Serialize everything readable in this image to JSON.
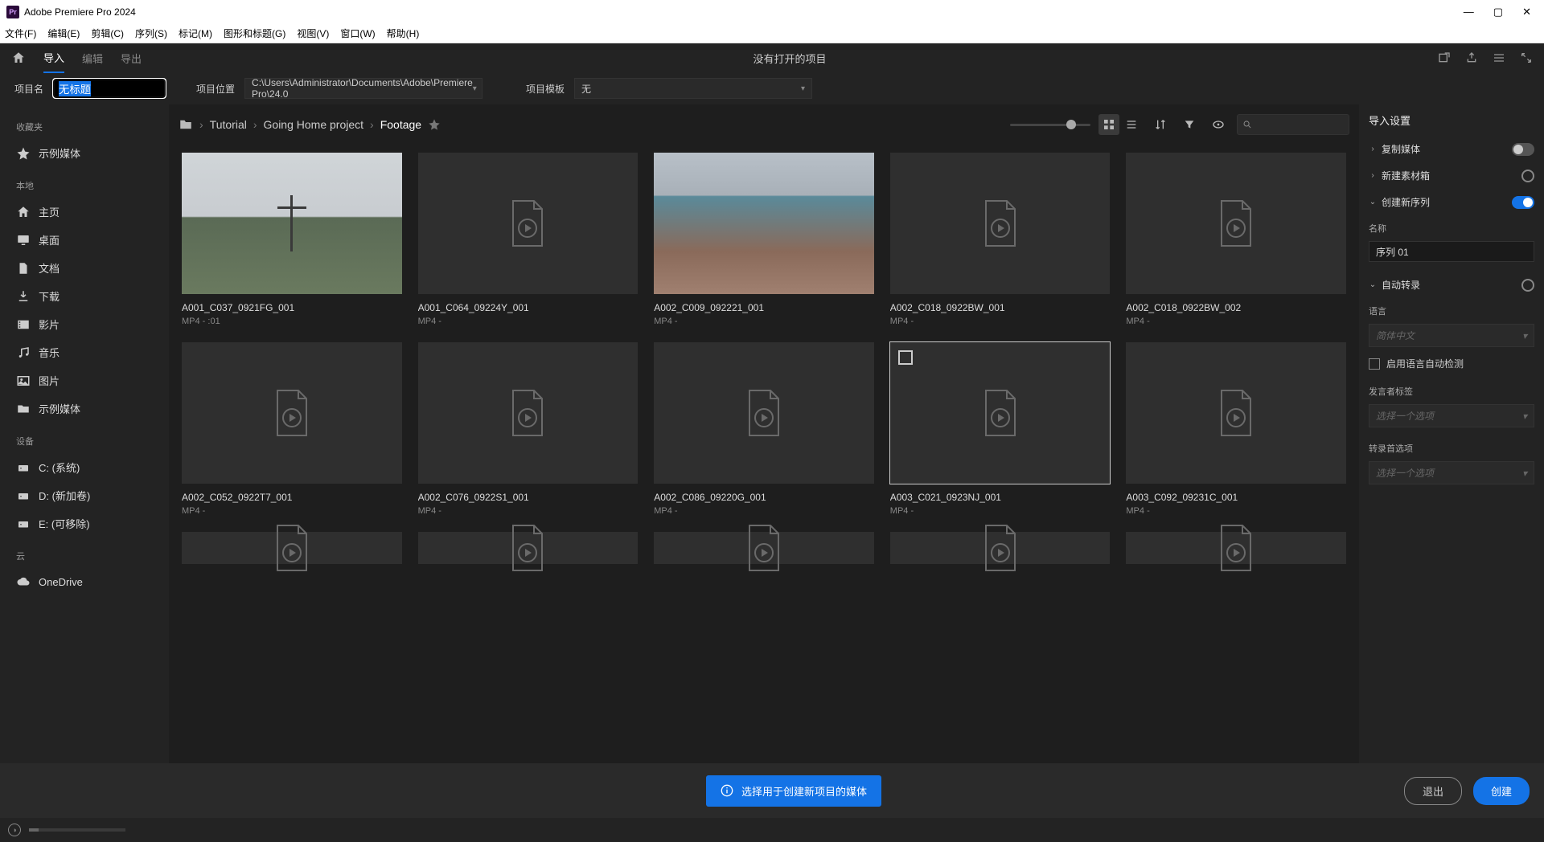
{
  "titlebar": {
    "appName": "Adobe Premiere Pro 2024"
  },
  "menubar": [
    "文件(F)",
    "编辑(E)",
    "剪辑(C)",
    "序列(S)",
    "标记(M)",
    "图形和标题(G)",
    "视图(V)",
    "窗口(W)",
    "帮助(H)"
  ],
  "header": {
    "tabs": [
      "导入",
      "编辑",
      "导出"
    ],
    "centerText": "没有打开的项目"
  },
  "config": {
    "projNameLabel": "项目名",
    "projNameValue": "无标题",
    "projLocLabel": "项目位置",
    "projLocValue": "C:\\Users\\Administrator\\Documents\\Adobe\\Premiere Pro\\24.0",
    "projTmplLabel": "项目模板",
    "projTmplValue": "无"
  },
  "sidebar": {
    "sections": [
      {
        "header": "收藏夹",
        "items": [
          {
            "icon": "star",
            "label": "示例媒体"
          }
        ]
      },
      {
        "header": "本地",
        "items": [
          {
            "icon": "home",
            "label": "主页"
          },
          {
            "icon": "desktop",
            "label": "桌面"
          },
          {
            "icon": "document",
            "label": "文档"
          },
          {
            "icon": "download",
            "label": "下载"
          },
          {
            "icon": "movie",
            "label": "影片"
          },
          {
            "icon": "music",
            "label": "音乐"
          },
          {
            "icon": "image",
            "label": "图片"
          },
          {
            "icon": "folder",
            "label": "示例媒体"
          }
        ]
      },
      {
        "header": "设备",
        "items": [
          {
            "icon": "drive",
            "label": "C: (系统)"
          },
          {
            "icon": "drive",
            "label": "D: (新加卷)"
          },
          {
            "icon": "drive",
            "label": "E: (可移除)"
          }
        ]
      },
      {
        "header": "云",
        "items": [
          {
            "icon": "cloud",
            "label": "OneDrive"
          }
        ]
      }
    ]
  },
  "breadcrumb": [
    "Tutorial",
    "Going Home project",
    "Footage"
  ],
  "clips": [
    {
      "name": "A001_C037_0921FG_001",
      "meta": "MP4 - :01",
      "thumb": "photo1"
    },
    {
      "name": "A001_C064_09224Y_001",
      "meta": "MP4 -",
      "thumb": "none"
    },
    {
      "name": "A002_C009_092221_001",
      "meta": "MP4 -",
      "thumb": "photo2"
    },
    {
      "name": "A002_C018_0922BW_001",
      "meta": "MP4 -",
      "thumb": "none"
    },
    {
      "name": "A002_C018_0922BW_002",
      "meta": "MP4 -",
      "thumb": "none"
    },
    {
      "name": "A002_C052_0922T7_001",
      "meta": "MP4 -",
      "thumb": "none"
    },
    {
      "name": "A002_C076_0922S1_001",
      "meta": "MP4 -",
      "thumb": "none"
    },
    {
      "name": "A002_C086_09220G_001",
      "meta": "MP4 -",
      "thumb": "none"
    },
    {
      "name": "A003_C021_0923NJ_001",
      "meta": "MP4 -",
      "thumb": "none",
      "selected": true
    },
    {
      "name": "A003_C092_09231C_001",
      "meta": "MP4 -",
      "thumb": "none"
    },
    {
      "name": "",
      "meta": "",
      "thumb": "none",
      "partial": true
    },
    {
      "name": "",
      "meta": "",
      "thumb": "none",
      "partial": true
    },
    {
      "name": "",
      "meta": "",
      "thumb": "none",
      "partial": true
    },
    {
      "name": "",
      "meta": "",
      "thumb": "none",
      "partial": true
    },
    {
      "name": "",
      "meta": "",
      "thumb": "none",
      "partial": true
    }
  ],
  "settings": {
    "title": "导入设置",
    "rows": {
      "copyMedia": "复制媒体",
      "newBin": "新建素材箱",
      "newSeq": "创建新序列",
      "autoTrans": "自动转录"
    },
    "nameLabel": "名称",
    "seqName": "序列 01",
    "langLabel": "语言",
    "langValue": "简体中文",
    "autoDetect": "启用语言自动检测",
    "speakerLabel": "发言者标签",
    "speakerPlaceholder": "选择一个选项",
    "transOptLabel": "转录首选项",
    "transOptPlaceholder": "选择一个选项"
  },
  "infoBar": {
    "text": "选择用于创建新项目的媒体"
  },
  "actions": {
    "exit": "退出",
    "create": "创建"
  }
}
